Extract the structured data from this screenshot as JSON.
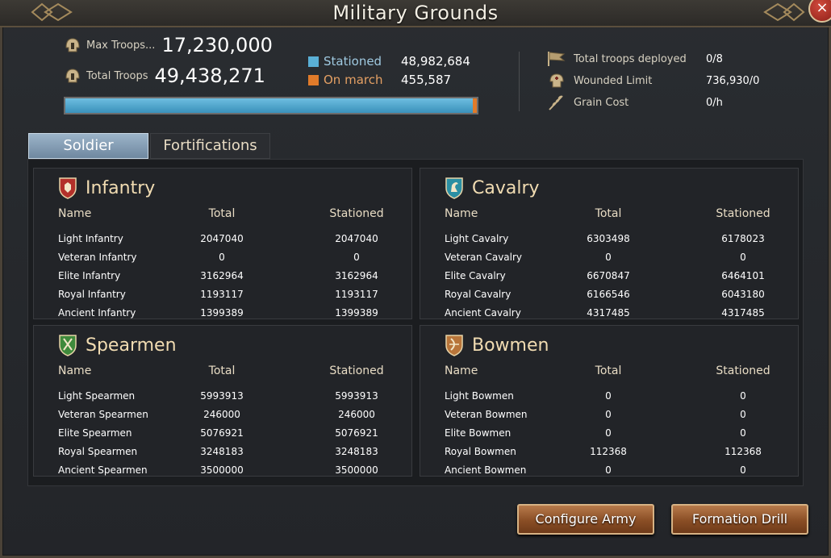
{
  "window": {
    "title": "Military Grounds",
    "close_symbol": "×"
  },
  "summary": {
    "max_troops_label": "Max Troops...",
    "max_troops_value": "17,230,000",
    "total_troops_label": "Total Troops",
    "total_troops_value": "49,438,271",
    "legend": [
      {
        "label": "Stationed",
        "value": "48,982,684",
        "color": "#5ab0d6"
      },
      {
        "label": "On march",
        "value": "455,587",
        "color": "#e07b2a"
      }
    ],
    "progress_stationed_fraction": 0.99,
    "stats": [
      {
        "label": "Total troops deployed",
        "value": "0/8",
        "icon": "flag-icon"
      },
      {
        "label": "Wounded Limit",
        "value": "736,930/0",
        "icon": "wounded-icon"
      },
      {
        "label": "Grain Cost",
        "value": "0/h",
        "icon": "grain-icon"
      }
    ]
  },
  "tabs": {
    "soldier": "Soldier",
    "fortifications": "Fortifications"
  },
  "columns": {
    "name": "Name",
    "total": "Total",
    "stationed": "Stationed"
  },
  "panels": {
    "infantry": {
      "title": "Infantry",
      "shield_color": "#b3302a",
      "rows": [
        {
          "name": "Light Infantry",
          "total": "2047040",
          "stationed": "2047040"
        },
        {
          "name": "Veteran Infantry",
          "total": "0",
          "stationed": "0"
        },
        {
          "name": "Elite Infantry",
          "total": "3162964",
          "stationed": "3162964"
        },
        {
          "name": "Royal Infantry",
          "total": "1193117",
          "stationed": "1193117"
        },
        {
          "name": "Ancient Infantry",
          "total": "1399389",
          "stationed": "1399389"
        }
      ]
    },
    "cavalry": {
      "title": "Cavalry",
      "shield_color": "#2b8fa3",
      "rows": [
        {
          "name": "Light Cavalry",
          "total": "6303498",
          "stationed": "6178023"
        },
        {
          "name": "Veteran Cavalry",
          "total": "0",
          "stationed": "0"
        },
        {
          "name": "Elite Cavalry",
          "total": "6670847",
          "stationed": "6464101"
        },
        {
          "name": "Royal Cavalry",
          "total": "6166546",
          "stationed": "6043180"
        },
        {
          "name": "Ancient Cavalry",
          "total": "4317485",
          "stationed": "4317485"
        }
      ]
    },
    "spearmen": {
      "title": "Spearmen",
      "shield_color": "#3f8a3c",
      "rows": [
        {
          "name": "Light Spearmen",
          "total": "5993913",
          "stationed": "5993913"
        },
        {
          "name": "Veteran Spearmen",
          "total": "246000",
          "stationed": "246000"
        },
        {
          "name": "Elite Spearmen",
          "total": "5076921",
          "stationed": "5076921"
        },
        {
          "name": "Royal Spearmen",
          "total": "3248183",
          "stationed": "3248183"
        },
        {
          "name": "Ancient Spearmen",
          "total": "3500000",
          "stationed": "3500000"
        }
      ]
    },
    "bowmen": {
      "title": "Bowmen",
      "shield_color": "#b8753a",
      "rows": [
        {
          "name": "Light Bowmen",
          "total": "0",
          "stationed": "0"
        },
        {
          "name": "Veteran Bowmen",
          "total": "0",
          "stationed": "0"
        },
        {
          "name": "Elite Bowmen",
          "total": "0",
          "stationed": "0"
        },
        {
          "name": "Royal Bowmen",
          "total": "112368",
          "stationed": "112368"
        },
        {
          "name": "Ancient Bowmen",
          "total": "0",
          "stationed": "0"
        }
      ]
    }
  },
  "buttons": {
    "configure_army": "Configure Army",
    "formation_drill": "Formation Drill"
  }
}
